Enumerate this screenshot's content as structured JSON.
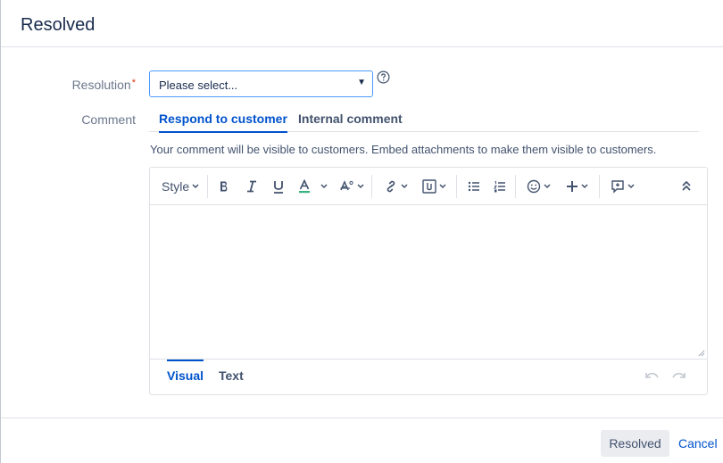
{
  "dialog": {
    "title": "Resolved"
  },
  "form": {
    "resolution_label": "Resolution",
    "required_mark": "*",
    "resolution_value": "Please select...",
    "comment_label": "Comment"
  },
  "comment_tabs": [
    {
      "label": "Respond to customer",
      "active": true
    },
    {
      "label": "Internal comment",
      "active": false
    }
  ],
  "notice": "Your comment will be visible to customers. Embed attachments to make them visible to customers.",
  "toolbar": {
    "style_label": "Style"
  },
  "editor_modes": [
    {
      "label": "Visual",
      "active": true
    },
    {
      "label": "Text",
      "active": false
    }
  ],
  "footer": {
    "submit_label": "Resolved",
    "cancel_label": "Cancel"
  },
  "colors": {
    "accent": "#0052cc",
    "text_color_underline": "#36b37e",
    "required": "#de350b",
    "focus_border": "#4c9aff"
  },
  "icons": [
    "help-icon",
    "bold-icon",
    "italic-icon",
    "underline-icon",
    "text-color-icon",
    "text-effects-icon",
    "link-icon",
    "attachment-icon",
    "bullet-list-icon",
    "numbered-list-icon",
    "emoji-icon",
    "insert-more-icon",
    "mention-icon",
    "collapse-toolbar-icon",
    "undo-icon",
    "redo-icon"
  ]
}
